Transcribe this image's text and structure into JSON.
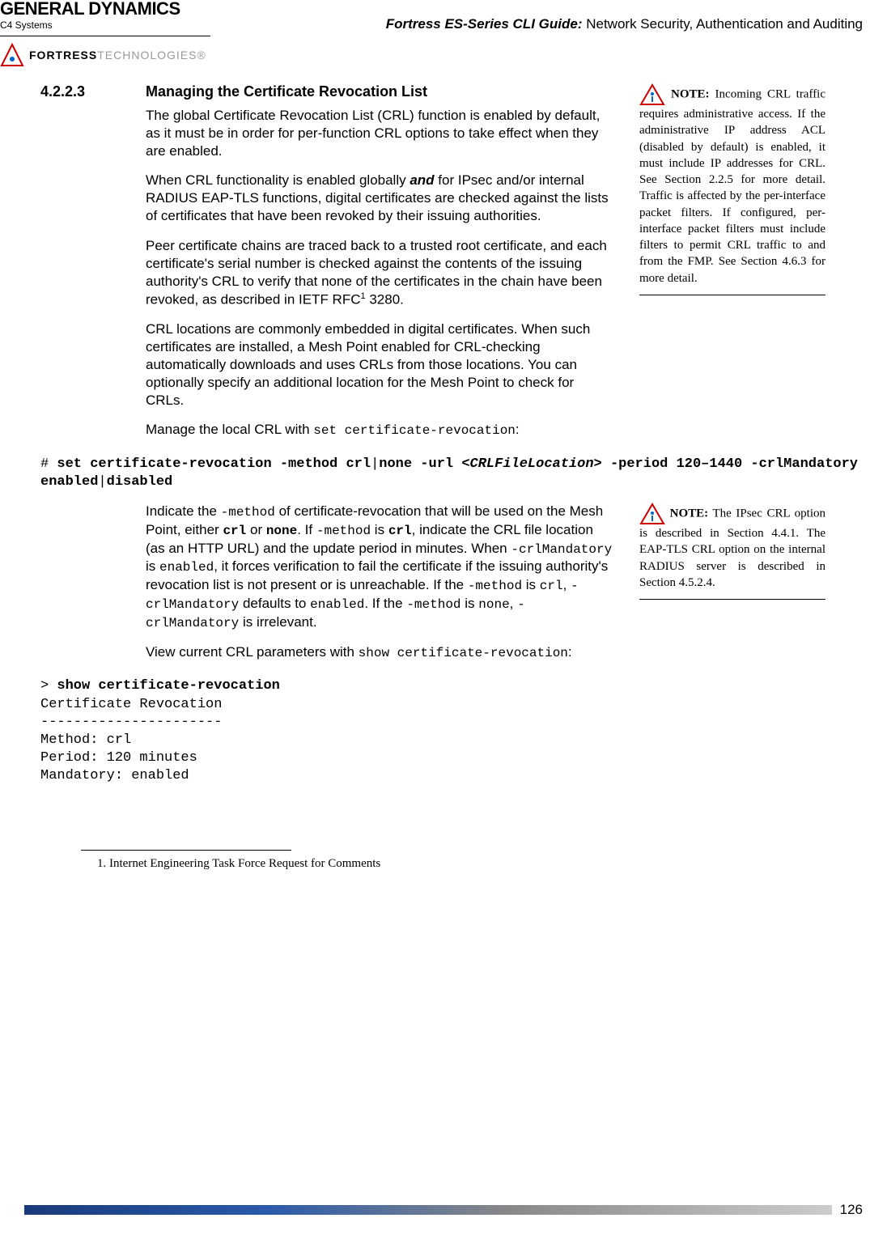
{
  "header": {
    "brand_top": "GENERAL DYNAMICS",
    "brand_sub": "C4 Systems",
    "fortress": "FORTRESS",
    "tech": "TECHNOLOGIES",
    "guide_italic": "Fortress ES-Series CLI Guide:",
    "guide_rest": " Network Security, Authentication and Auditing"
  },
  "section": {
    "num": "4.2.2.3",
    "title": "Managing the Certificate Revocation List"
  },
  "paras": {
    "p1": "The global Certificate Revocation List (CRL) function is enabled by default, as it must be in order for per-function CRL options to take effect when they are enabled.",
    "p2a": "When CRL functionality is enabled globally ",
    "p2and": "and",
    "p2b": " for IPsec and/or internal RADIUS EAP-TLS functions, digital certificates are checked against the lists of certificates that have been revoked by their issuing authorities.",
    "p3a": "Peer certificate chains are traced back to a trusted root certificate, and each certificate's serial number is checked against the contents of the issuing authority's CRL to verify that none of the certificates in the chain have been revoked, as described in IETF RFC",
    "p3sup": "1",
    "p3b": " 3280.",
    "p4": "CRL locations are commonly embedded in digital certificates. When such certificates are installed, a Mesh Point enabled for CRL-checking automatically downloads and uses CRLs from those locations. You can optionally specify an additional location for the Mesh Point to check for CRLs.",
    "p5a": "Manage the local CRL with ",
    "p5cmd": "set certificate-revocation",
    "p5b": ":",
    "p6a": "Indicate the ",
    "p6m1": "-method",
    "p6b": " of certificate-revocation that will be used on the Mesh Point, either ",
    "p6crl": "crl",
    "p6or": " or ",
    "p6none": "none",
    "p6c": ". If ",
    "p6m2": "-method",
    "p6d": " is ",
    "p6crl2": "crl",
    "p6e": ", indicate the CRL file location (as an HTTP URL) and the update period in minutes. When ",
    "p6cm": "-crlMandatory",
    "p6f": " is ",
    "p6en": "enabled",
    "p6g": ", it forces verification to fail the certificate if the issuing authority's revocation list is not present or is unreachable. If the ",
    "p6m3": "-method",
    "p6h": " is ",
    "p6crl3": "crl",
    "p6i": ", ",
    "p6cm2": "-crlMandatory",
    "p6j": " defaults to ",
    "p6en2": "enabled",
    "p6k": ". If the ",
    "p6m4": "-method",
    "p6l": " is ",
    "p6none2": "none",
    "p6n": ", ",
    "p6cm3": "-crlMandatory",
    "p6o": " is irrelevant.",
    "p7a": "View current CRL parameters with ",
    "p7cmd": "show certificate-revocation",
    "p7b": ":"
  },
  "cmd1": {
    "hash": "# ",
    "b1": "set certificate-revocation -method crl",
    "pipe1": "|",
    "b2": "none -url ",
    "it": "<CRLFileLocation>",
    "b3": " -period 120–1440 -crlMandatory enabled",
    "pipe2": "|",
    "b4": "disabled"
  },
  "cmd2": {
    "gt": "> ",
    "show": "show certificate-revocation",
    "l1": "Certificate Revocation",
    "l2": "----------------------",
    "l3": "Method: crl",
    "l4": "Period: 120 minutes",
    "l5": "Mandatory: enabled"
  },
  "note1": {
    "label": "NOTE:",
    "text": " Incoming CRL traffic requires administrative access. If the administrative IP address ACL (disabled by default) is enabled, it must include IP addresses for CRL. See Section 2.2.5 for more detail. Traffic is affected by the per-interface packet filters. If configured, per-interface packet filters must include filters to permit CRL traffic to and from the FMP. See Section 4.6.3 for more detail."
  },
  "note2": {
    "label": "NOTE:",
    "text": " The IPsec CRL option is described in Section 4.4.1. The EAP-TLS CRL option on the internal RADIUS server is described in Section 4.5.2.4."
  },
  "footnote": "1.  Internet Engineering Task Force Request for Comments",
  "page": "126"
}
